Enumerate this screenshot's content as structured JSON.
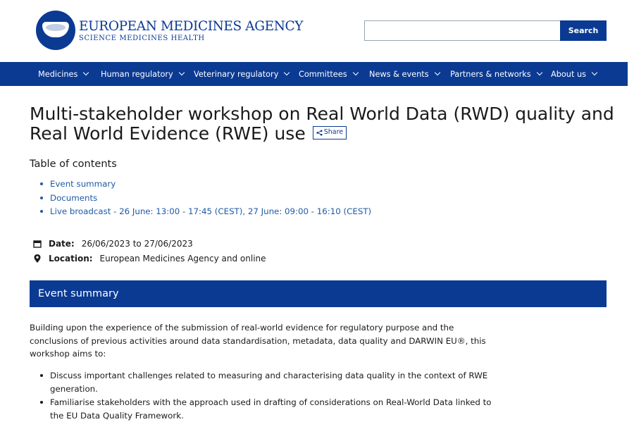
{
  "header": {
    "brand_name": "EUROPEAN MEDICINES AGENCY",
    "brand_tagline": "SCIENCE  MEDICINES  HEALTH",
    "search_value": "",
    "search_button_label": "Search"
  },
  "nav": {
    "items": [
      {
        "label": "Medicines",
        "icon": "chevron-down-icon"
      },
      {
        "label": "Human regulatory",
        "icon": "chevron-down-icon"
      },
      {
        "label": "Veterinary regulatory",
        "icon": "chevron-down-icon"
      },
      {
        "label": "Committees",
        "icon": "chevron-down-icon"
      },
      {
        "label": "News & events",
        "icon": "chevron-down-icon"
      },
      {
        "label": "Partners & networks",
        "icon": "chevron-down-icon"
      },
      {
        "label": "About us",
        "icon": "chevron-down-icon"
      }
    ]
  },
  "page": {
    "title": "Multi-stakeholder workshop on Real World Data (RWD) quality and Real World Evidence (RWE) use",
    "share_label": "Share",
    "toc_heading": "Table of contents",
    "toc": [
      "Event summary",
      "Documents",
      "Live broadcast - 26 June: 13:00 - 17:45 (CEST), 27 June: 09:00 - 16:10 (CEST)"
    ],
    "date_label": "Date:",
    "date_value": "26/06/2023 to 27/06/2023",
    "location_label": "Location:",
    "location_value": "European Medicines Agency and online",
    "section_title": "Event summary",
    "intro": "Building upon the experience of the submission of real-world evidence for regulatory purpose and the conclusions of previous activities around data standardisation, metadata, data quality and DARWIN EU®, this workshop aims to:",
    "aims": [
      "Discuss important challenges related to measuring and characterising data quality in the context of RWE generation.",
      "Familiarise stakeholders with the approach used in drafting of considerations on Real-World Data linked to the EU Data Quality Framework."
    ]
  },
  "colors": {
    "brand_blue": "#0b3a93",
    "link_blue": "#1f5aa6",
    "text": "#1a1a1a"
  }
}
